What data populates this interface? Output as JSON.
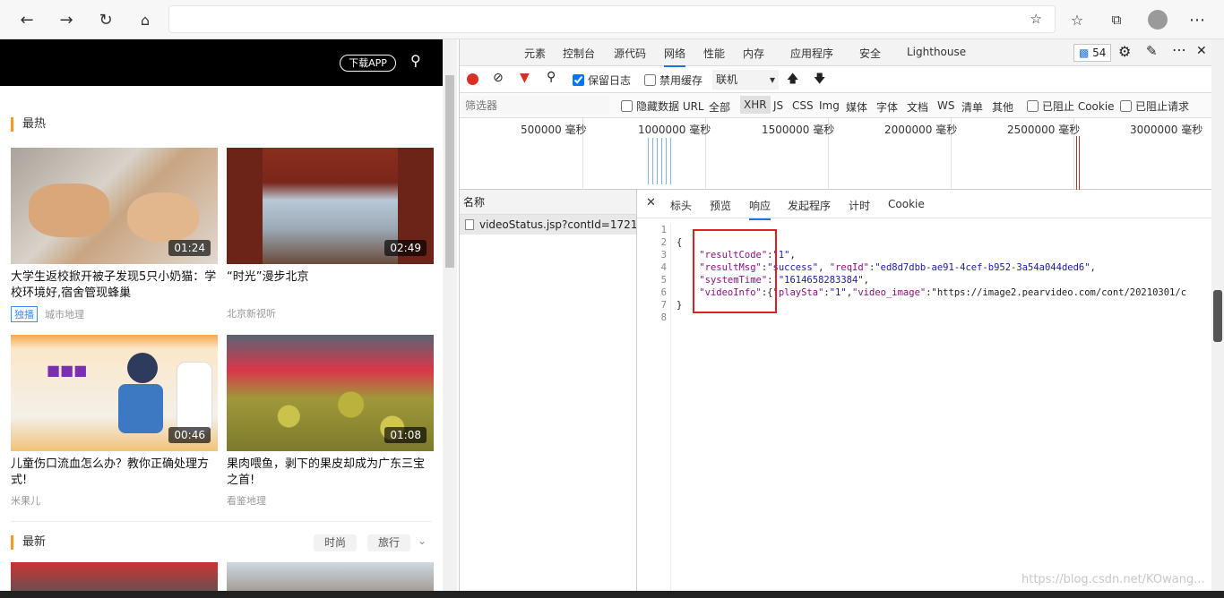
{
  "browser": {
    "address_placeholder": "",
    "icons": [
      "back-icon",
      "forward-icon",
      "refresh-icon",
      "home-icon",
      "favorite-add-icon",
      "favorites-icon",
      "collections-icon",
      "profile-avatar",
      "more-icon"
    ]
  },
  "site": {
    "download_label": "下载APP",
    "hot_title": "最热",
    "new_title": "最新",
    "cards": [
      {
        "title": "大学生返校掀开被子发现5只小奶猫：学校环境好,宿舍管现蜂巢",
        "duration": "01:24",
        "badge": "独播",
        "source": "城市地理"
      },
      {
        "title": "“时光”漫步北京",
        "duration": "02:49",
        "badge": "",
        "source": "北京新视听"
      },
      {
        "title": "儿童伤口流血怎么办？教你正确处理方式!",
        "duration": "00:46",
        "badge": "",
        "source": "米果儿"
      },
      {
        "title": "果肉喂鱼，剥下的果皮却成为广东三宝之首!",
        "duration": "01:08",
        "badge": "",
        "source": "看鉴地理"
      }
    ],
    "filters": [
      "时尚",
      "旅行"
    ]
  },
  "devtools": {
    "tabs": [
      "元素",
      "控制台",
      "源代码",
      "网络",
      "性能",
      "内存",
      "应用程序",
      "安全",
      "Lighthouse"
    ],
    "active_tab": "网络",
    "issue_count": "54",
    "preserve_log": "保留日志",
    "disable_cache": "禁用缓存",
    "throttle": "联机",
    "filter_placeholder": "筛选器",
    "hide_data_urls": "隐藏数据 URL",
    "type_filters": [
      "全部",
      "XHR",
      "JS",
      "CSS",
      "Img",
      "媒体",
      "字体",
      "文档",
      "WS",
      "清单",
      "其他"
    ],
    "blocked_cookies": "已阻止 Cookie",
    "blocked_requests": "已阻止请求",
    "timeline_labels": [
      "500000 毫秒",
      "1000000 毫秒",
      "1500000 毫秒",
      "2000000 毫秒",
      "2500000 毫秒",
      "3000000 毫秒"
    ],
    "name_header": "名称",
    "request_name": "videoStatus.jsp?contId=17217...",
    "panel_tabs": [
      "标头",
      "预览",
      "响应",
      "发起程序",
      "计时",
      "Cookie"
    ],
    "active_panel_tab": "响应",
    "line_numbers": [
      "1",
      "2",
      "3",
      "4",
      "5",
      "6",
      "7",
      "8"
    ],
    "code_lines": [
      "",
      "{",
      "    \"resultCode\":\"1\",",
      "    \"resultMsg\":\"success\", \"reqId\":\"ed8d7dbb-ae91-4cef-b952-3a54a044ded6\",",
      "    \"systemTime\": \"1614658283384\",",
      "    \"videoInfo\":{\"playSta\":\"1\",\"video_image\":\"https://image2.pearvideo.com/cont/20210301/c",
      "}",
      ""
    ]
  },
  "watermark": "https://blog.csdn.net/KOwang..."
}
